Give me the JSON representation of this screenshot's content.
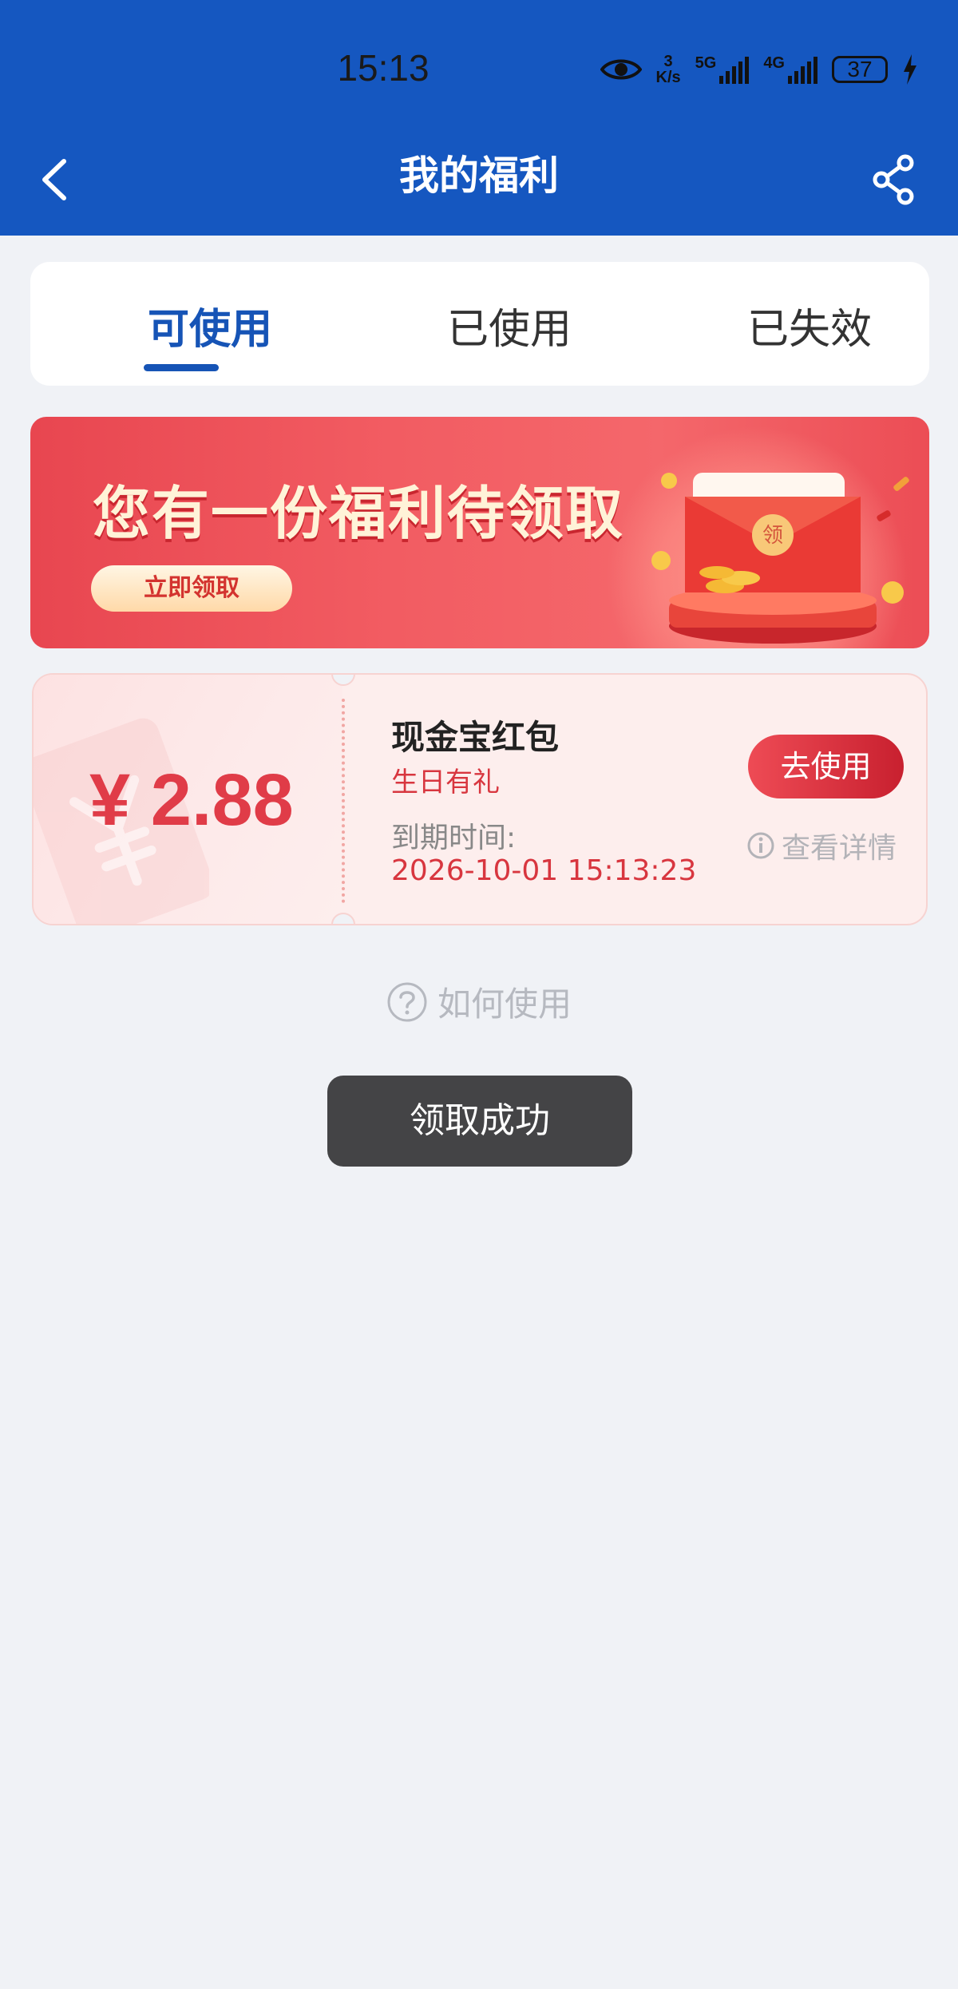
{
  "status_bar": {
    "time": "15:13",
    "speed_value": "3",
    "speed_unit": "K/s",
    "net_1": "5G",
    "net_2": "4G",
    "battery": "37"
  },
  "nav": {
    "title": "我的福利"
  },
  "tabs": [
    {
      "label": "可使用",
      "active": true
    },
    {
      "label": "已使用",
      "active": false
    },
    {
      "label": "已失效",
      "active": false
    }
  ],
  "banner": {
    "title": "您有一份福利待领取",
    "button_label": "立即领取",
    "envelope_char": "领"
  },
  "coupon": {
    "amount": "¥ 2.88",
    "name": "现金宝红包",
    "subtitle": "生日有礼",
    "expiry_label": "到期时间:",
    "expiry_value": "2026-10-01 15:13:23",
    "use_button": "去使用",
    "detail_link": "查看详情"
  },
  "help": {
    "label": "如何使用"
  },
  "toast": {
    "message": "领取成功"
  },
  "colors": {
    "header_bg": "#1557c0",
    "accent_blue": "#1654b6",
    "accent_red": "#e03c48",
    "page_bg": "#f0f2f6"
  }
}
